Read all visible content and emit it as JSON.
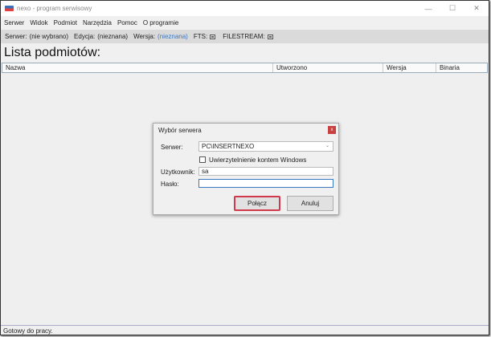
{
  "window": {
    "title": "nexo - program serwisowy",
    "minimize": "—",
    "maximize": "☐",
    "close": "✕"
  },
  "menu": [
    "Serwer",
    "Widok",
    "Podmiot",
    "Narzędzia",
    "Pomoc",
    "O programie"
  ],
  "toolbar": {
    "server_label": "Serwer:",
    "server_value": "(nie wybrano)",
    "edition_label": "Edycja:",
    "edition_value": "(nieznana)",
    "version_label": "Wersja:",
    "version_value": "(nieznana)",
    "fts_label": "FTS:",
    "filestream_label": "FILESTREAM:"
  },
  "page_title": "Lista podmiotów:",
  "columns": [
    "Nazwa",
    "Utworzono",
    "Wersja",
    "Binaria"
  ],
  "status": "Gotowy do pracy.",
  "dialog": {
    "title": "Wybór serwera",
    "close": "x",
    "server_label": "Serwer:",
    "server_value": "PC\\INSERTNEXO",
    "windows_auth_label": "Uwierzytelnienie kontem Windows",
    "windows_auth_checked": false,
    "user_label": "Użytkownik:",
    "user_value": "sa",
    "password_label": "Hasło:",
    "password_value": "",
    "connect": "Połącz",
    "cancel": "Anuluj"
  }
}
